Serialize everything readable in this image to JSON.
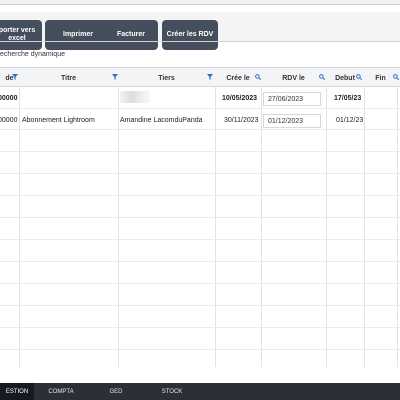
{
  "toolbar": {
    "export_label": "porter vers excel",
    "print_label": "Imprimer",
    "invoice_label": "Facturer",
    "create_rdv_label": "Créer les RDV"
  },
  "search": {
    "label": "echerche dynamique"
  },
  "table": {
    "columns": {
      "code": "de",
      "titre": "Titre",
      "tiers": "Tiers",
      "cree_le": "Crée le",
      "rdv_le": "RDV le",
      "debut": "Debut",
      "fin": "Fin"
    },
    "rows": [
      {
        "code": "00000",
        "titre": "",
        "tiers": "",
        "cree_le": "10/05/2023",
        "rdv_le": "27/06/2023",
        "debut": "17/05/23"
      },
      {
        "code": "00000",
        "titre": "Abonnement Lightroom",
        "tiers": "Amandine LacomduPanda",
        "cree_le": "30/11/2023",
        "rdv_le": "01/12/2023",
        "debut": "01/12/23"
      }
    ]
  },
  "bottom_tabs": [
    "ESTION",
    "COMPTA",
    "GED",
    "STOCK"
  ],
  "colors": {
    "button_bg": "#454e5c",
    "bottom_bar": "#2a2f38",
    "filter_icon": "#2f6fd1"
  }
}
